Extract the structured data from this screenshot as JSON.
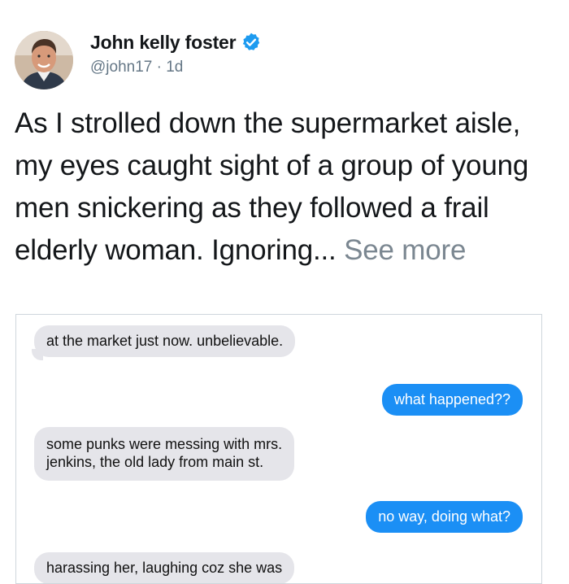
{
  "post": {
    "author_name": "John kelly foster",
    "handle": "@john17",
    "separator": " · ",
    "age": "1d",
    "text": "As I strolled down the supermarket aisle, my eyes caught sight of a group of young men snickering as they followed a frail elderly woman. Ignoring... ",
    "see_more": "See more"
  },
  "icons": {
    "verified": "verified-badge-icon",
    "avatar": "profile-photo"
  },
  "colors": {
    "verified_blue": "#1d9bf0",
    "outgoing_bubble": "#1b8ff5",
    "incoming_bubble": "#e5e5ea",
    "see_more": "#7b8791"
  },
  "conversation": {
    "messages": [
      {
        "direction": "incoming",
        "text": "at the market just now. unbelievable."
      },
      {
        "direction": "outgoing",
        "text": "what happened??"
      },
      {
        "direction": "incoming",
        "line1": "some punks were messing with mrs.",
        "line2": "jenkins, the old lady from main st."
      },
      {
        "direction": "outgoing",
        "text": "no way, doing what?"
      },
      {
        "direction": "incoming",
        "text": "harassing her, laughing coz she was"
      }
    ]
  }
}
